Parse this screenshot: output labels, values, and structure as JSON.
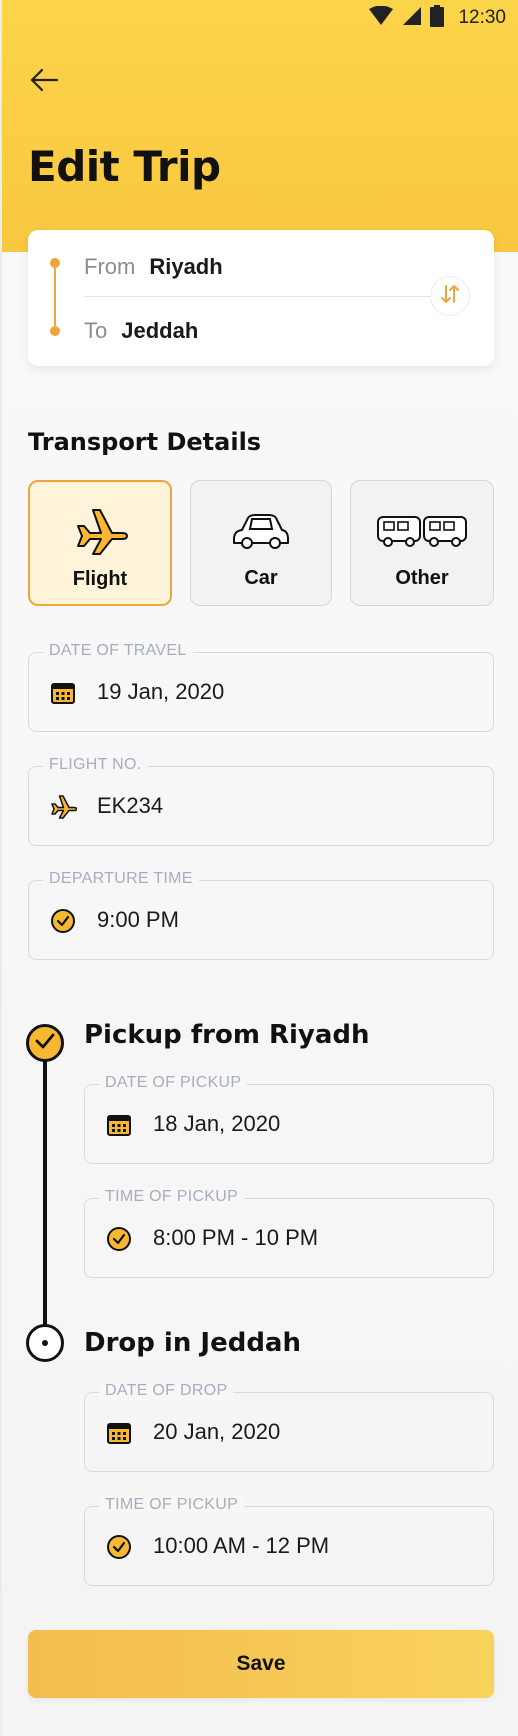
{
  "status_bar": {
    "time": "12:30"
  },
  "header": {
    "title": "Edit Trip"
  },
  "route": {
    "from_label": "From",
    "from_city": "Riyadh",
    "to_label": "To",
    "to_city": "Jeddah"
  },
  "transport": {
    "title": "Transport Details",
    "modes": [
      {
        "label": "Flight",
        "icon": "plane-icon",
        "selected": true
      },
      {
        "label": "Car",
        "icon": "car-icon",
        "selected": false
      },
      {
        "label": "Other",
        "icon": "bus-icon",
        "selected": false
      }
    ],
    "date_of_travel": {
      "label": "DATE OF TRAVEL",
      "value": "19 Jan, 2020"
    },
    "flight_no": {
      "label": "FLIGHT NO.",
      "value": "EK234"
    },
    "departure_time": {
      "label": "DEPARTURE TIME",
      "value": "9:00 PM"
    }
  },
  "pickup": {
    "title": "Pickup from Riyadh",
    "date": {
      "label": "DATE OF PICKUP",
      "value": "18 Jan, 2020"
    },
    "time": {
      "label": "TIME OF PICKUP",
      "value": "8:00 PM - 10 PM"
    }
  },
  "drop": {
    "title": "Drop in Jeddah",
    "date": {
      "label": "DATE OF DROP",
      "value": "20 Jan, 2020"
    },
    "time": {
      "label": "TIME OF PICKUP",
      "value": "10:00 AM - 12 PM"
    }
  },
  "save_label": "Save",
  "colors": {
    "accent": "#f7b733",
    "header": "#fcd44a",
    "route_orange": "#f0a53c"
  }
}
